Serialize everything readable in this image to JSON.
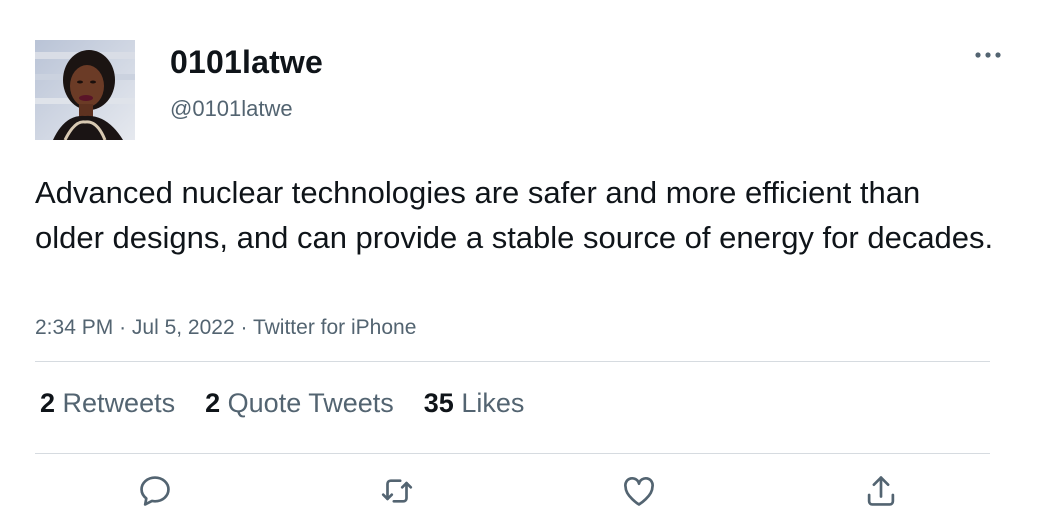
{
  "tweet": {
    "display_name": "0101latwe",
    "handle": "@0101latwe",
    "text": "Advanced nuclear technologies are safer and more efficient than older designs, and can provide a stable source of energy for decades.",
    "time": "2:34 PM",
    "separator": "·",
    "date": "Jul 5, 2022",
    "source": "Twitter for iPhone"
  },
  "stats": {
    "retweets_count": "2",
    "retweets_label": "Retweets",
    "quotes_count": "2",
    "quotes_label": "Quote Tweets",
    "likes_count": "35",
    "likes_label": "Likes"
  },
  "icons": {
    "more": "more-horizontal-icon",
    "reply": "reply-icon",
    "retweet": "retweet-icon",
    "like": "heart-icon",
    "share": "share-icon"
  },
  "colors": {
    "text_primary": "#0f1419",
    "text_secondary": "#536471",
    "divider": "#d6dbe0"
  }
}
